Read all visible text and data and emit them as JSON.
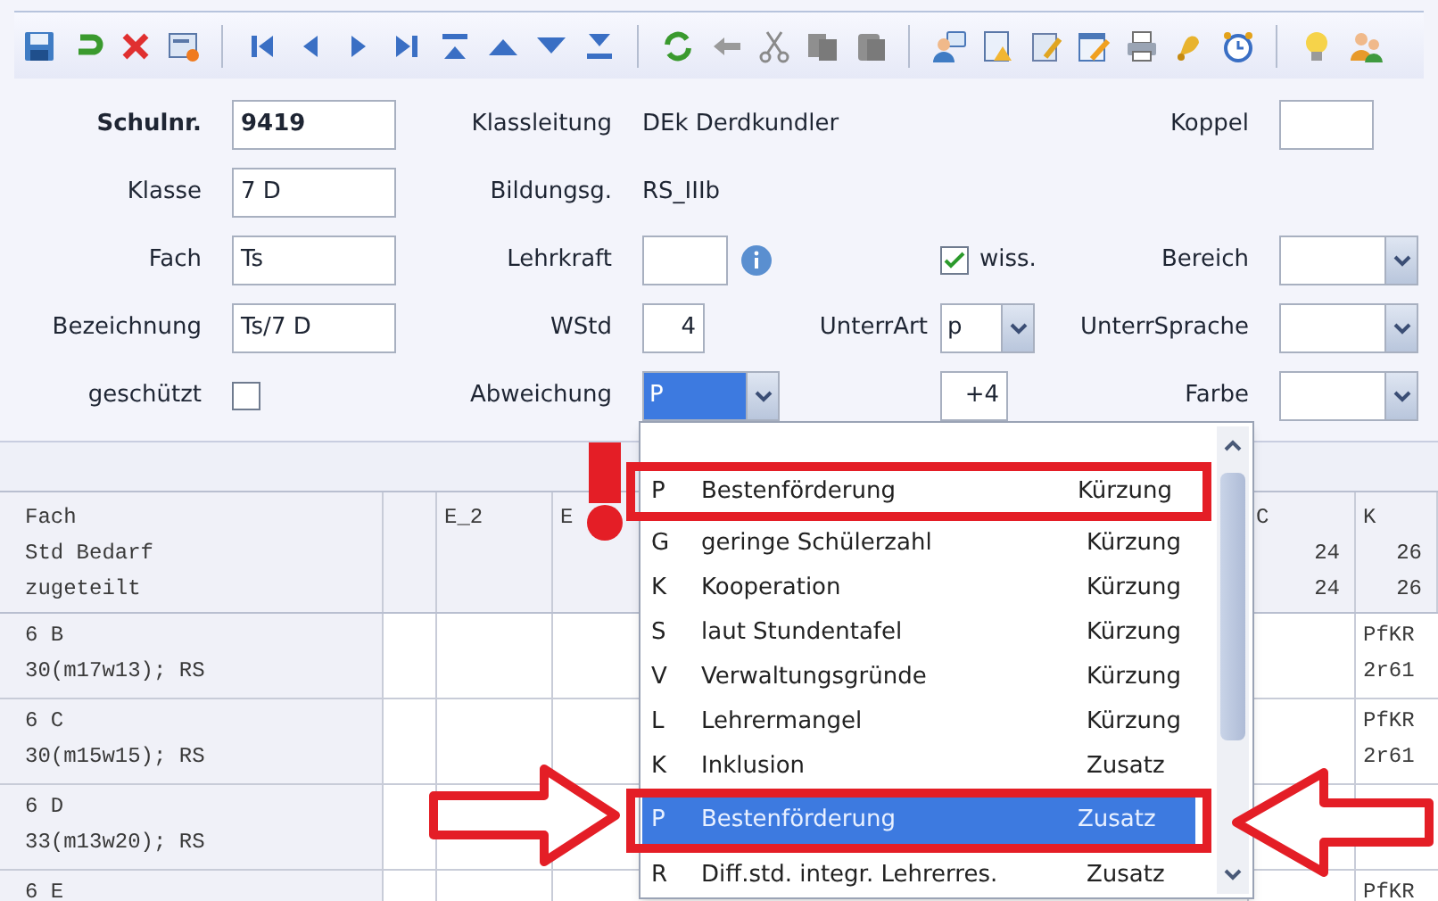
{
  "form": {
    "school_no": {
      "label": "Schulnr.",
      "value": "9419"
    },
    "class_teacher": {
      "label": "Klassleitung",
      "value": "DEk Derdkundler"
    },
    "koppel": {
      "label": "Koppel"
    },
    "klasse": {
      "label": "Klasse",
      "value": "7 D"
    },
    "bildungsgang": {
      "label": "Bildungsg.",
      "value": "RS_IIIb"
    },
    "fach": {
      "label": "Fach",
      "value": "Ts"
    },
    "lehrkraft": {
      "label": "Lehrkraft"
    },
    "wiss": {
      "label": "wiss.",
      "checked": true
    },
    "bereich": {
      "label": "Bereich"
    },
    "bezeichnung": {
      "label": "Bezeichnung",
      "value": "Ts/7 D"
    },
    "wstd": {
      "label": "WStd",
      "value": "4"
    },
    "unterrart": {
      "label": "UnterrArt",
      "value": "p"
    },
    "unterrsprache": {
      "label": "UnterrSprache"
    },
    "geschuetzt": {
      "label": "geschützt",
      "checked": false
    },
    "abweichung": {
      "label": "Abweichung",
      "value": "P",
      "selected": true
    },
    "offset": {
      "value": "+4"
    },
    "farbe": {
      "label": "Farbe"
    }
  },
  "grid": {
    "columns": [
      {
        "lines": [
          "Fach",
          "Std Bedarf",
          "zugeteilt"
        ]
      },
      {},
      {
        "lines": [
          "E_2"
        ]
      },
      {
        "lines": [
          "E"
        ]
      },
      {
        "lines": [
          "C",
          "24",
          "24"
        ]
      },
      {
        "lines": [
          "K",
          "26",
          "26"
        ]
      }
    ],
    "rows": [
      {
        "lines": [
          "6 B",
          "30(m17w13); RS"
        ],
        "last_cell": [
          "PfKR",
          "2r61"
        ]
      },
      {
        "lines": [
          "6 C",
          "30(m15w15); RS"
        ],
        "last_cell": [
          "PfKR",
          "2r61"
        ]
      },
      {
        "lines": [
          "6 D",
          "33(m13w20); RS"
        ]
      },
      {
        "lines": [
          "6 E"
        ],
        "last_cell": [
          "PfKR"
        ]
      }
    ]
  },
  "dropdown": {
    "items": [
      {
        "code": "P",
        "name": "Bestenförderung",
        "type": "Kürzung",
        "selected": false,
        "highlighted": true
      },
      {
        "code": "G",
        "name": "geringe Schülerzahl",
        "type": "Kürzung",
        "selected": false,
        "highlighted": false
      },
      {
        "code": "K",
        "name": "Kooperation",
        "type": "Kürzung",
        "selected": false,
        "highlighted": false
      },
      {
        "code": "S",
        "name": "laut Stundentafel",
        "type": "Kürzung",
        "selected": false,
        "highlighted": false
      },
      {
        "code": "V",
        "name": "Verwaltungsgründe",
        "type": "Kürzung",
        "selected": false,
        "highlighted": false
      },
      {
        "code": "L",
        "name": "Lehrermangel",
        "type": "Kürzung",
        "selected": false,
        "highlighted": false
      },
      {
        "code": "K",
        "name": "Inklusion",
        "type": "Zusatz",
        "selected": false,
        "highlighted": false
      },
      {
        "code": "P",
        "name": "Bestenförderung",
        "type": "Zusatz",
        "selected": true,
        "highlighted": true
      },
      {
        "code": "R",
        "name": "Diff.std. integr. Lehrerres.",
        "type": "Zusatz",
        "selected": false,
        "highlighted": false
      }
    ]
  }
}
